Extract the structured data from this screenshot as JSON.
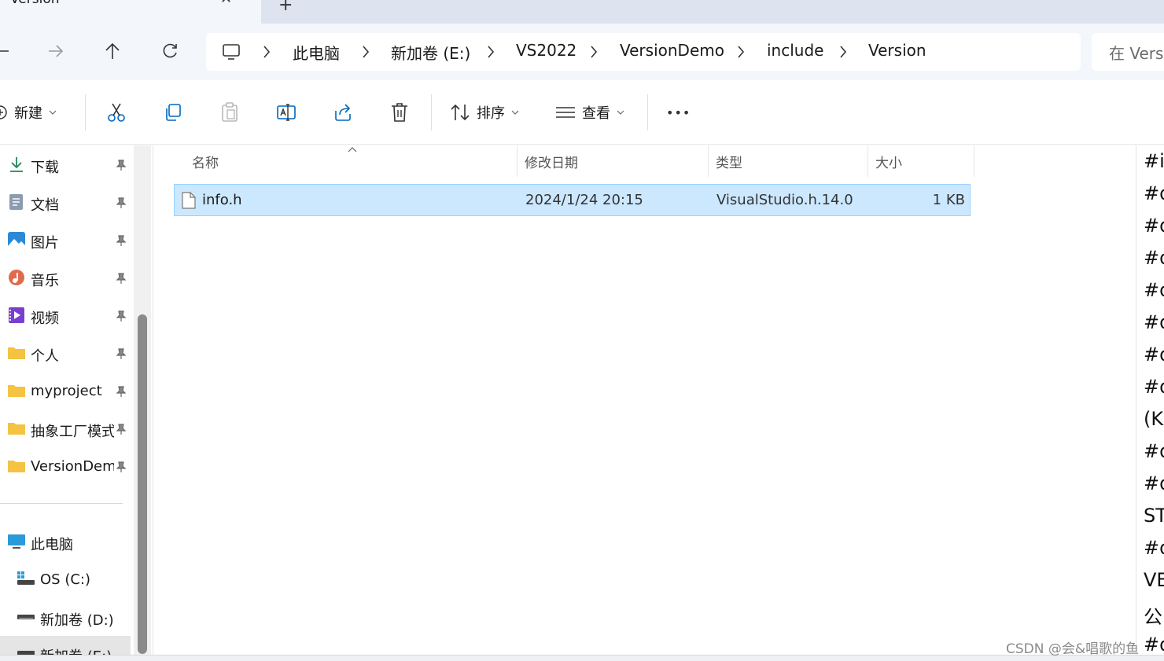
{
  "tab": {
    "title": "Version",
    "close_glyph": "✕",
    "new_glyph": "+"
  },
  "address": {
    "root_icon": "computer-icon",
    "crumbs": [
      "此电脑",
      "新加卷 (E:)",
      "VS2022",
      "VersionDemo",
      "include",
      "Version"
    ]
  },
  "search": {
    "placeholder": "在 Versi"
  },
  "commands": {
    "new_label": "新建",
    "sort_label": "排序",
    "view_label": "查看",
    "more_glyph": "•••"
  },
  "sidebar": {
    "quick_access": [
      {
        "label": "下载",
        "icon": "download-icon"
      },
      {
        "label": "文档",
        "icon": "document-icon"
      },
      {
        "label": "图片",
        "icon": "pictures-icon"
      },
      {
        "label": "音乐",
        "icon": "music-icon"
      },
      {
        "label": "视频",
        "icon": "video-icon"
      },
      {
        "label": "个人",
        "icon": "folder-icon"
      },
      {
        "label": "myproject",
        "icon": "folder-icon"
      },
      {
        "label": "抽象工厂模式",
        "icon": "folder-icon"
      },
      {
        "label": "VersionDem",
        "icon": "folder-icon"
      }
    ],
    "this_pc": {
      "label": "此电脑",
      "icon": "computer-icon"
    },
    "drives": [
      {
        "label": "OS (C:)",
        "icon": "windows-drive-icon"
      },
      {
        "label": "新加卷 (D:)",
        "icon": "drive-icon"
      },
      {
        "label": "新加卷 (E:)",
        "icon": "drive-icon"
      }
    ]
  },
  "columns": {
    "name": "名称",
    "modified": "修改日期",
    "type": "类型",
    "size": "大小"
  },
  "files": [
    {
      "name": "info.h",
      "modified": "2024/1/24 20:15",
      "type": "VisualStudio.h.14.0",
      "size": "1 KB"
    }
  ],
  "preview_lines": [
    "#if",
    "#d",
    "#d",
    "#d",
    "#d",
    "#d",
    "#d",
    "#d",
    "(KI",
    "#d",
    "#d",
    "ST",
    "#d",
    "VE",
    "公司",
    "#d"
  ],
  "watermark": "CSDN @会&唱歌的鱼",
  "colors": {
    "selection": "#cce8ff",
    "selection_border": "#99d1ff",
    "folder": "#f5c342",
    "accent": "#0067c0"
  }
}
